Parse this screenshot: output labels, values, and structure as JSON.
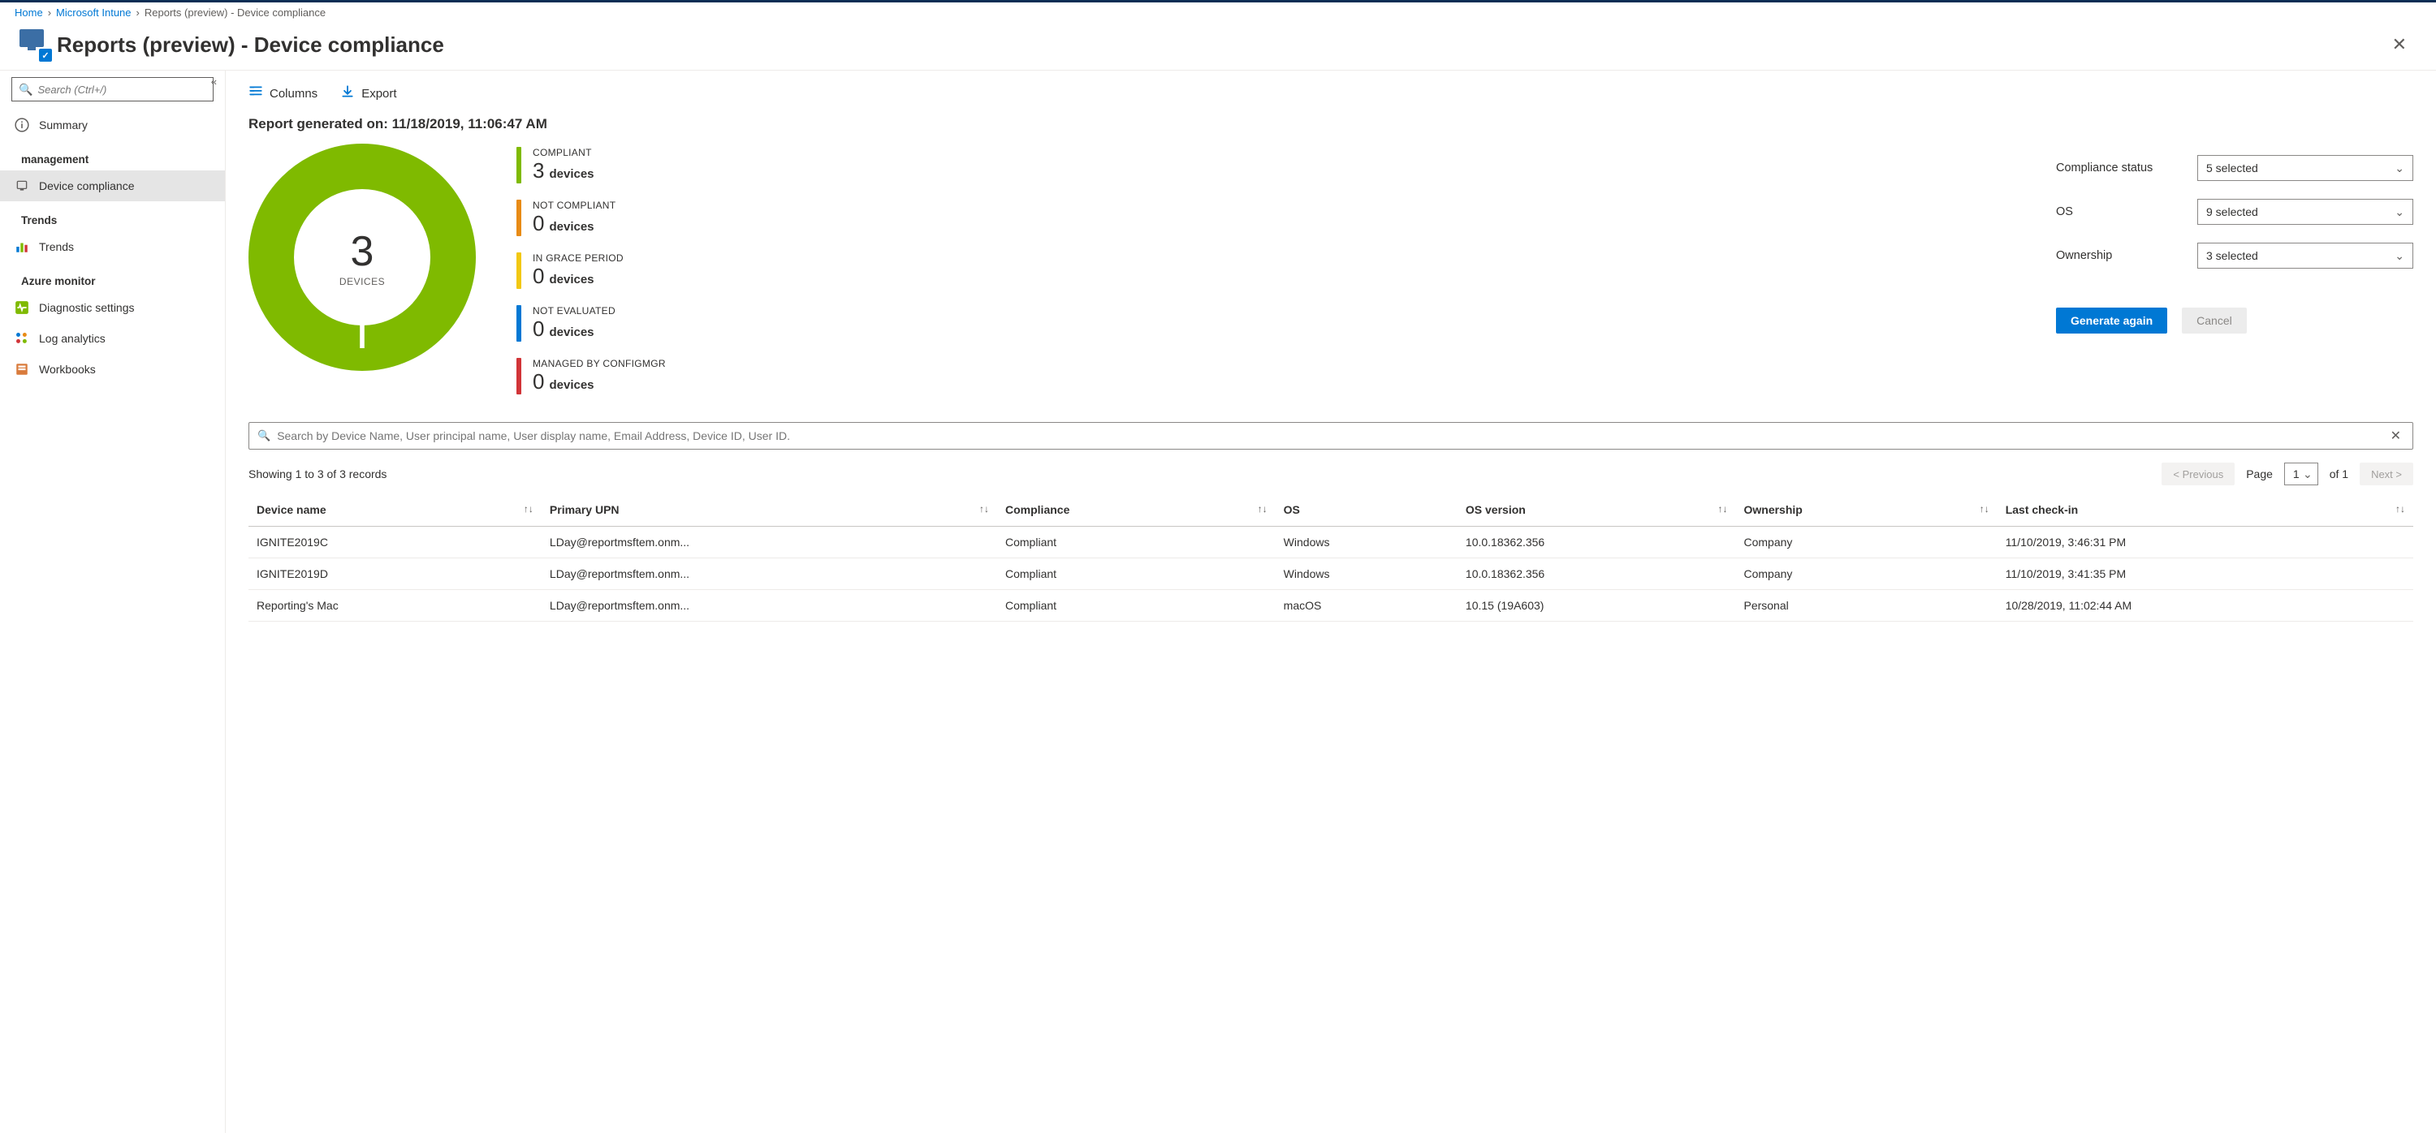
{
  "breadcrumbs": {
    "home": "Home",
    "intune": "Microsoft Intune",
    "current": "Reports (preview) - Device compliance"
  },
  "page_title": "Reports (preview) - Device compliance",
  "search_placeholder": "Search (Ctrl+/)",
  "sidebar": {
    "overview": "Summary",
    "mgmt_heading": "management",
    "device_compliance": "Device compliance",
    "trends_heading": "Trends",
    "trends": "Trends",
    "azmon_heading": "Azure monitor",
    "diag": "Diagnostic settings",
    "loganalytics": "Log analytics",
    "workbooks": "Workbooks"
  },
  "toolbar": {
    "columns": "Columns",
    "export": "Export"
  },
  "generated_label": "Report generated on: 11/18/2019, 11:06:47 AM",
  "chart_data": {
    "type": "pie",
    "total_label": "DEVICES",
    "total": 3,
    "series": [
      {
        "name": "COMPLIANT",
        "value": 3,
        "color": "#7fba00"
      },
      {
        "name": "NOT COMPLIANT",
        "value": 0,
        "color": "#e88b16"
      },
      {
        "name": "IN GRACE PERIOD",
        "value": 0,
        "color": "#f2c811"
      },
      {
        "name": "NOT EVALUATED",
        "value": 0,
        "color": "#0078d4"
      },
      {
        "name": "MANAGED BY CONFIGMGR",
        "value": 0,
        "color": "#d13438"
      }
    ],
    "unit": "devices"
  },
  "filters": {
    "compliance_label": "Compliance status",
    "compliance_value": "5 selected",
    "os_label": "OS",
    "os_value": "9 selected",
    "ownership_label": "Ownership",
    "ownership_value": "3 selected",
    "generate_btn": "Generate again",
    "cancel_btn": "Cancel"
  },
  "table_search_placeholder": "Search by Device Name, User principal name, User display name, Email Address, Device ID, User ID.",
  "records_text": "Showing 1 to 3 of 3 records",
  "paging": {
    "prev": "< Previous",
    "page_label": "Page",
    "page_value": "1",
    "of_text": "of 1",
    "next": "Next >"
  },
  "columns": {
    "device_name": "Device name",
    "upn": "Primary UPN",
    "compliance": "Compliance",
    "os": "OS",
    "os_version": "OS version",
    "ownership": "Ownership",
    "last_checkin": "Last check-in"
  },
  "rows": [
    {
      "device_name": "IGNITE2019C",
      "upn": "LDay@reportmsftem.onm...",
      "compliance": "Compliant",
      "os": "Windows",
      "os_version": "10.0.18362.356",
      "ownership": "Company",
      "last_checkin": "11/10/2019, 3:46:31 PM"
    },
    {
      "device_name": "IGNITE2019D",
      "upn": "LDay@reportmsftem.onm...",
      "compliance": "Compliant",
      "os": "Windows",
      "os_version": "10.0.18362.356",
      "ownership": "Company",
      "last_checkin": "11/10/2019, 3:41:35 PM"
    },
    {
      "device_name": "Reporting's Mac",
      "upn": "LDay@reportmsftem.onm...",
      "compliance": "Compliant",
      "os": "macOS",
      "os_version": "10.15 (19A603)",
      "ownership": "Personal",
      "last_checkin": "10/28/2019, 11:02:44 AM"
    }
  ]
}
